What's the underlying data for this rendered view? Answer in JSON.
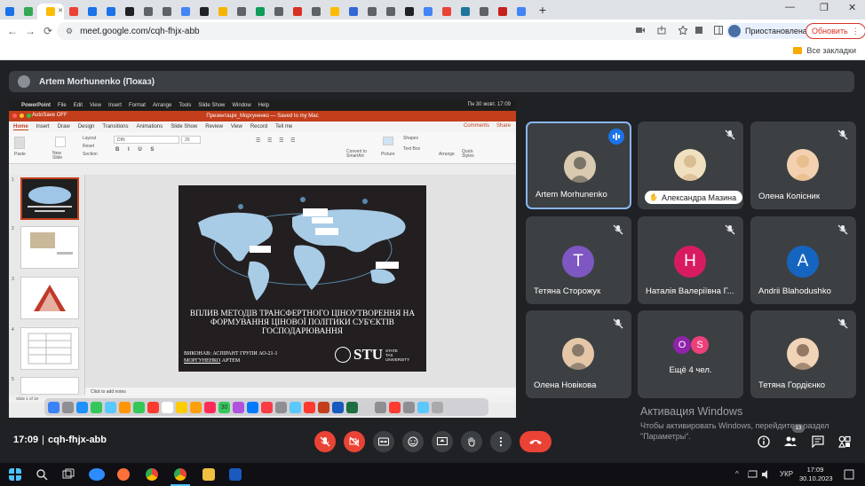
{
  "browser": {
    "url": "meet.google.com/cqh-fhjx-abb",
    "profile_label": "Приостановлена",
    "update_label": "Обновить",
    "bookmarks_all": "Все закладки",
    "new_tab": "+",
    "win_minimize": "—",
    "win_restore": "❐",
    "win_close": "✕",
    "tab_favicon_colors": [
      "#1a73e8",
      "#34a853",
      "#fbbc04",
      "#ea4335",
      "#1a73e8",
      "#1a73e8",
      "#202124",
      "#5f6368",
      "#5f6368",
      "#4285f4",
      "#202124",
      "#f4b400",
      "#5f6368",
      "#0f9d58",
      "#5f6368",
      "#d93025",
      "#5f6368",
      "#fbbc04",
      "#3367d6",
      "#5f6368",
      "#5f6368",
      "#202124",
      "#4285f4",
      "#ea4335",
      "#21759b",
      "#5f6368",
      "#c5221f",
      "#4285f4"
    ]
  },
  "meet": {
    "presenter_label": "Artem Morhunenko (Показ)",
    "time": "17:09",
    "meeting_code": "cqh-fhjx-abb",
    "participants_count": "13",
    "participants": [
      {
        "name": "Artem Morhunenko",
        "avatar": "photo",
        "speaking": true
      },
      {
        "name": "Александра Мазина",
        "avatar": "photo",
        "hand_raised": true
      },
      {
        "name": "Олена Колісник",
        "avatar": "photo"
      },
      {
        "name": "Тетяна Сторожук",
        "avatar": "letter",
        "letter": "T",
        "color": "#7e57c2"
      },
      {
        "name": "Наталія Валеріївна Г...",
        "avatar": "letter",
        "letter": "H",
        "color": "#d81b60"
      },
      {
        "name": "Andrii Blahodushko",
        "avatar": "letter",
        "letter": "A",
        "color": "#1565c0"
      },
      {
        "name": "Олена Новікова",
        "avatar": "photo"
      },
      {
        "name": "Ещё 4 чел.",
        "avatar": "more",
        "letters": [
          "O",
          "S"
        ],
        "colors": [
          "#8e24aa",
          "#ec407a"
        ]
      },
      {
        "name": "Тетяна Гордієнко",
        "avatar": "photo"
      }
    ]
  },
  "mac": {
    "menu_items": [
      "PowerPoint",
      "File",
      "Edit",
      "View",
      "Insert",
      "Format",
      "Arrange",
      "Tools",
      "Slide Show",
      "Window",
      "Help"
    ],
    "clock": "Пн 30 жовт. 17:09"
  },
  "ppt": {
    "autosave": "AutoSave",
    "autosave_state": "OFF",
    "doc_title": "Презентація_Моргуненко — Saved to my Mac",
    "ribbon_tabs": [
      "Home",
      "Insert",
      "Draw",
      "Design",
      "Transitions",
      "Animations",
      "Slide Show",
      "Review",
      "View",
      "Record",
      "Tell me"
    ],
    "comments": "Comments",
    "share": "Share",
    "ribbon_labels": {
      "paste": "Paste",
      "new_slide": "New Slide",
      "layout": "Layout",
      "reset": "Reset",
      "section": "Section",
      "font": "DIN",
      "size": "20",
      "convert": "Convert to SmartArt",
      "picture": "Picture",
      "shapes": "Shapes",
      "text_box": "Text Box",
      "arrange": "Arrange",
      "quick_styles": "Quick Styles"
    },
    "thumbnail_numbers": [
      "1",
      "2",
      "3",
      "4",
      "5"
    ],
    "slide_title": "ВПЛИВ МЕТОДІВ ТРАНСФЕРТНОГО ЦІНОУТВОРЕННЯ НА ФОРМУВАННЯ ЦІНОВОЇ ПОЛІТИКИ СУБ'ЄКТІВ ГОСПОДАРЮВАННЯ",
    "slide_author_line1": "ВИКОНАВ: АСПІРАНТ ГРУПИ АО-21-1",
    "slide_author_surname": "МОРГУНЕНКО",
    "slide_author_name": "АРТЕМ",
    "logo_text": "STU",
    "logo_small": [
      "STATE",
      "TAX",
      "UNIVERSITY"
    ],
    "notes_placeholder": "Click to add notes",
    "status": "Slide 1 of 19",
    "dock_date": "30"
  },
  "windows": {
    "activation_title": "Активация Windows",
    "activation_text_line1": "Чтобы активировать Windows, перейдите в раздел",
    "activation_text_line2": "\"Параметры\".",
    "lang": "УКР",
    "clock_time": "17:09",
    "clock_date": "30.10.2023"
  }
}
